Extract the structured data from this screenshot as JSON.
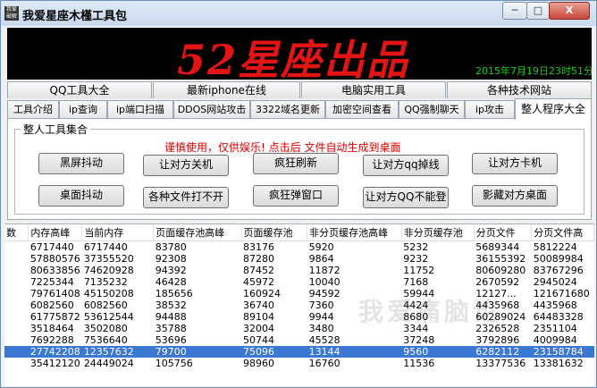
{
  "window": {
    "app_icon_text": "我爱破解",
    "title": "我爱星座木槿工具包",
    "controls": {
      "minimize": "─",
      "maximize": "□",
      "close": "X"
    }
  },
  "banner": {
    "headline": "52星座出品",
    "clock": "2015年7月19日23时51分4"
  },
  "top_tabs": [
    "QQ工具大全",
    "最新iphone在线",
    "电脑实用工具",
    "各种技术网站"
  ],
  "sub_tabs": [
    "工具介绍",
    "ip查询",
    "ip端口扫描",
    "DDOS网站攻击",
    "3322域名更新",
    "加密空间查看",
    "QQ强制聊天",
    "ip攻击",
    "整人程序大全"
  ],
  "active_sub_tab": "整人程序大全",
  "panel": {
    "group_label": "整人工具集合",
    "warning": "谨慎使用，仅供娱乐! 点击后 文件自动生成到桌面",
    "buttons": [
      "黑屏抖动",
      "让对方关机",
      "疯狂刷新",
      "让对方qq掉线",
      "让对方卡机",
      "桌面抖动",
      "各种文件打不开",
      "疯狂弹窗口",
      "让对方QQ不能登",
      "影藏对方桌面"
    ]
  },
  "table": {
    "headers": [
      "数",
      "内存高峰",
      "当前内存",
      "页面缓存池高峰",
      "页面缓存池",
      "非分页缓存池高峰",
      "非分页缓存池",
      "分页文件",
      "分页文件高"
    ],
    "rows": [
      [
        "",
        "6717440",
        "6717440",
        "83780",
        "83176",
        "5920",
        "5232",
        "5689344",
        "5812224"
      ],
      [
        "",
        "57880576",
        "37355520",
        "92308",
        "87280",
        "9864",
        "9232",
        "36155392",
        "50089984"
      ],
      [
        "",
        "80633856",
        "74620928",
        "94392",
        "87452",
        "11872",
        "11752",
        "80609280",
        "83767296"
      ],
      [
        "",
        "7225344",
        "7135232",
        "46428",
        "45972",
        "10040",
        "7168",
        "2670592",
        "2945024"
      ],
      [
        "",
        "79761408",
        "45150208",
        "185656",
        "160924",
        "94592",
        "59944",
        "12127...",
        "121671680"
      ],
      [
        "",
        "6082560",
        "6082560",
        "38532",
        "36740",
        "7360",
        "4424",
        "4435968",
        "4435968"
      ],
      [
        "",
        "61775872",
        "53612544",
        "94488",
        "89104",
        "9944",
        "8680",
        "60289024",
        "64483328"
      ],
      [
        "",
        "3518464",
        "3502080",
        "35788",
        "32004",
        "3480",
        "3344",
        "2326528",
        "2351104"
      ],
      [
        "",
        "7692288",
        "7536640",
        "53696",
        "50744",
        "45528",
        "37248",
        "3792896",
        "4009984"
      ],
      [
        "",
        "27742208",
        "12357632",
        "79700",
        "75096",
        "13144",
        "9560",
        "6282112",
        "23158784"
      ],
      [
        "",
        "35412120",
        "24449024",
        "105756",
        "98960",
        "16760",
        "11536",
        "13377536",
        "13381632"
      ]
    ],
    "selected_row": 9
  },
  "watermark": "我爱痛脑论"
}
